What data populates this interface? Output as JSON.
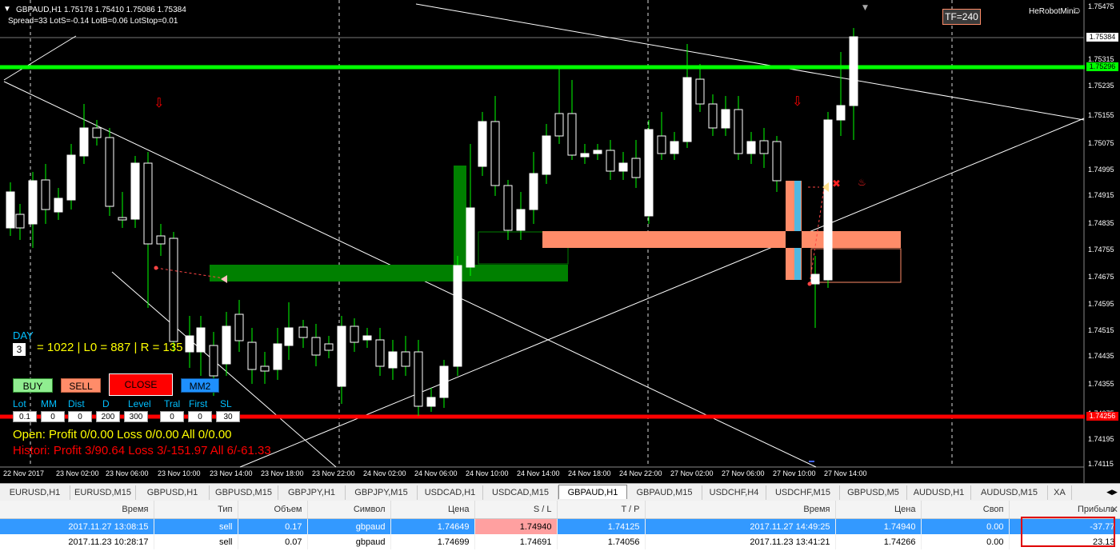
{
  "chart": {
    "symbol_line": "GBPAUD,H1  1.75178 1.75410 1.75086 1.75384",
    "spread_line": "Spread=33  LotS=-0.14  LotB=0.06  LotStop=0.01",
    "tf_badge": "TF=240",
    "robot_name": "HeRobotMini",
    "day_label": "DAY",
    "day_value": "3",
    "range_text": "= 1022 | L0 = 887 | R = 135",
    "buttons": {
      "buy": "BUY",
      "sell": "SELL",
      "close": "CLOSE",
      "mm2": "MM2"
    },
    "params": [
      {
        "label": "Lot",
        "value": "0.1"
      },
      {
        "label": "MM",
        "value": "0"
      },
      {
        "label": "Dist",
        "value": "0"
      },
      {
        "label": "D",
        "value": "200"
      },
      {
        "label": "Level",
        "value": "300"
      },
      {
        "label": "Tral",
        "value": "0"
      },
      {
        "label": "First",
        "value": "0"
      },
      {
        "label": "SL",
        "value": "30"
      }
    ],
    "open_stats": "Open:  Profit 0/0.00  Loss 0/0.00  All 0/0.00",
    "history_stats": "Histori: Profit 3/90.64  Loss 3/-151.97  All 6/-61.33",
    "price_axis": [
      "1.75475",
      "1.75384",
      "1.75315",
      "1.75235",
      "1.75155",
      "1.75075",
      "1.74995",
      "1.74915",
      "1.74835",
      "1.74755",
      "1.74675",
      "1.74595",
      "1.74515",
      "1.74435",
      "1.74355",
      "1.74275",
      "1.74195",
      "1.74115"
    ],
    "price_tags": {
      "current": "1.75384",
      "green": "1.75296",
      "red": "1.74256"
    },
    "time_axis": [
      "22 Nov 2017",
      "23 Nov 02:00",
      "23 Nov 06:00",
      "23 Nov 10:00",
      "23 Nov 14:00",
      "23 Nov 18:00",
      "23 Nov 22:00",
      "24 Nov 02:00",
      "24 Nov 06:00",
      "24 Nov 10:00",
      "24 Nov 14:00",
      "24 Nov 18:00",
      "24 Nov 22:00",
      "27 Nov 02:00",
      "27 Nov 06:00",
      "27 Nov 10:00",
      "27 Nov 14:00"
    ],
    "colors": {
      "background": "#000000",
      "green_level": "#00ff00",
      "red_level": "#ff0000",
      "up_candle": "#ffffff",
      "wick": "#00ff00",
      "zone_green": "#008000",
      "zone_salmon": "#ff8c69"
    }
  },
  "tabs": [
    {
      "label": "EURUSD,H1"
    },
    {
      "label": "EURUSD,M15"
    },
    {
      "label": "GBPUSD,H1"
    },
    {
      "label": "GBPUSD,M15"
    },
    {
      "label": "GBPJPY,H1"
    },
    {
      "label": "GBPJPY,M15"
    },
    {
      "label": "USDCAD,H1"
    },
    {
      "label": "USDCAD,M15"
    },
    {
      "label": "GBPAUD,H1",
      "active": true
    },
    {
      "label": "GBPAUD,M15"
    },
    {
      "label": "USDCHF,H4"
    },
    {
      "label": "USDCHF,M15"
    },
    {
      "label": "GBPUSD,M5"
    },
    {
      "label": "AUDUSD,H1"
    },
    {
      "label": "AUDUSD,M15"
    },
    {
      "label": "XA"
    }
  ],
  "trades": {
    "headers": [
      "Время",
      "Тип",
      "Объем",
      "Символ",
      "Цена",
      "S / L",
      "T / P",
      "Время",
      "Цена",
      "Своп",
      "Прибыль"
    ],
    "rows": [
      [
        "2017.11.27 13:08:15",
        "sell",
        "0.17",
        "gbpaud",
        "1.74649",
        "1.74940",
        "1.74125",
        "2017.11.27 14:49:25",
        "1.74940",
        "0.00",
        "-37.77"
      ],
      [
        "2017.11.23 10:28:17",
        "sell",
        "0.07",
        "gbpaud",
        "1.74699",
        "1.74691",
        "1.74056",
        "2017.11.23 13:41:21",
        "1.74266",
        "0.00",
        "23.13"
      ]
    ]
  }
}
